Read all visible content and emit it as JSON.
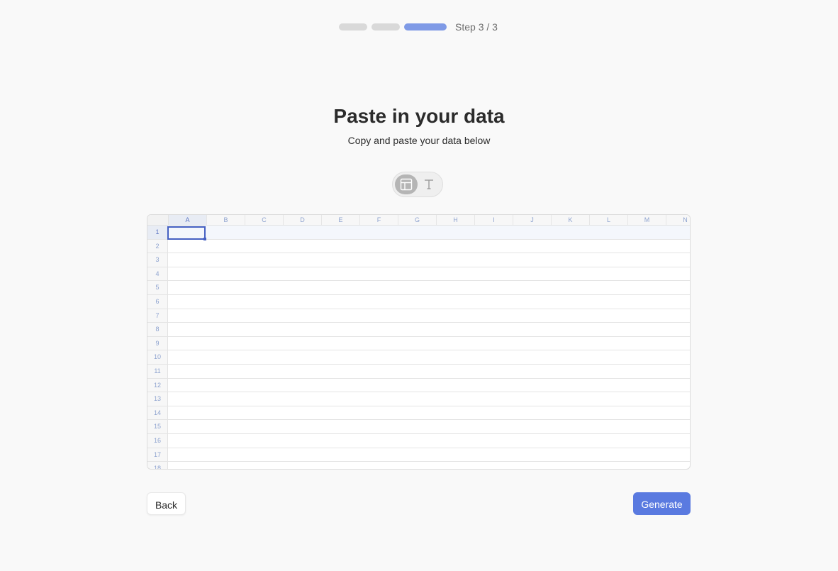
{
  "stepper": {
    "label": "Step 3 / 3",
    "total_steps": 3,
    "current_step": 3
  },
  "header": {
    "title": "Paste in your data",
    "subtitle": "Copy and paste your data below"
  },
  "mode_toggle": {
    "options": [
      {
        "name": "table-icon",
        "active": true
      },
      {
        "name": "text-icon",
        "active": false
      }
    ]
  },
  "sheet": {
    "columns": [
      "A",
      "B",
      "C",
      "D",
      "E",
      "F",
      "G",
      "H",
      "I",
      "J",
      "K",
      "L",
      "M",
      "N"
    ],
    "rows": [
      "1",
      "2",
      "3",
      "4",
      "5",
      "6",
      "7",
      "8",
      "9",
      "10",
      "11",
      "12",
      "13",
      "14",
      "15",
      "16",
      "17",
      "18"
    ],
    "selected_cell": "A1"
  },
  "buttons": {
    "back_label": "Back",
    "generate_label": "Generate"
  },
  "colors": {
    "accent": "#5a7ae0",
    "stepper_active": "#7f9ae6",
    "stepper_inactive": "#d9d9d9",
    "selection": "#4560c2"
  }
}
